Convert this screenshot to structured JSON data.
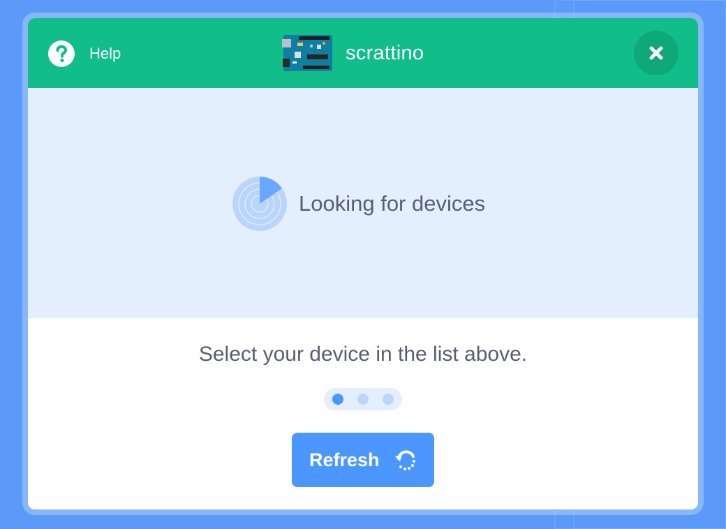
{
  "colors": {
    "page_background": "#5b9af8",
    "header": "#11be8a",
    "close_button": "#0fa878",
    "scan_panel": "#e4effd",
    "text": "#575e75",
    "primary_button": "#4c97ff",
    "step_active": "#4c97ff",
    "step_inactive": "#bcd6fb"
  },
  "header": {
    "help_label": "Help",
    "help_icon": "question-circle-icon",
    "device_icon": "arduino-board-icon",
    "title": "scrattino",
    "close_icon": "close-x-icon"
  },
  "scan": {
    "status": "Looking for devices",
    "icon": "radar-scan-icon"
  },
  "footer": {
    "instruction": "Select your device in the list above.",
    "steps": {
      "total": 3,
      "active": 1
    },
    "refresh_label": "Refresh",
    "refresh_icon": "refresh-icon"
  }
}
